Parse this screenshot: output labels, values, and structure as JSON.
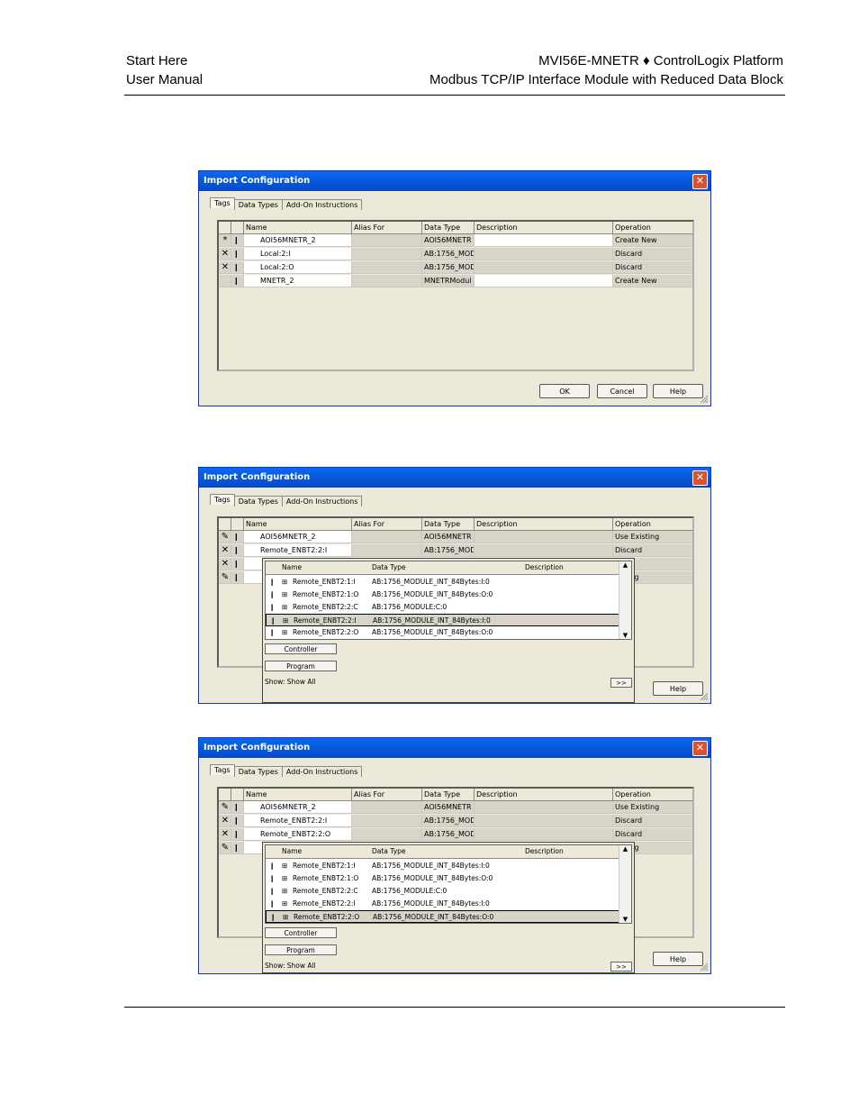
{
  "header": {
    "left_line1": "Start Here",
    "left_line2": "User Manual",
    "right_line1": "MVI56E-MNETR ♦ ControlLogix Platform",
    "right_line2": "Modbus TCP/IP Interface Module with Reduced Data Block"
  },
  "dialog": {
    "title": "Import Configuration",
    "close": "✕",
    "tabs": [
      "Tags",
      "Data Types",
      "Add-On Instructions"
    ],
    "columns": [
      "Name",
      "Alias For",
      "Data Type",
      "Description",
      "Operation"
    ],
    "ok": "OK",
    "cancel": "Cancel",
    "help": "Help",
    "show": "Show: Show All",
    "more": ">>",
    "controller": "Controller",
    "program": "Program",
    "popup_columns": [
      "Name",
      "Data Type",
      "Description"
    ]
  },
  "dialog1": {
    "rows": [
      {
        "marker": "*",
        "name": "AOI56MNETR_2",
        "type": "AOI56MNETR",
        "desc": "",
        "op": "Create New"
      },
      {
        "marker": "✕",
        "name": "Local:2:I",
        "type": "AB:1756_MOD",
        "desc": "",
        "op": "Discard"
      },
      {
        "marker": "✕",
        "name": "Local:2:O",
        "type": "AB:1756_MOD",
        "desc": "",
        "op": "Discard"
      },
      {
        "marker": "",
        "name": "MNETR_2",
        "type": "MNETRModul",
        "desc": "",
        "op": "Create New"
      }
    ]
  },
  "dialog2": {
    "rows": [
      {
        "marker": "✎",
        "name": "AOI56MNETR_2",
        "type": "AOI56MNETR",
        "op": "Use Existing"
      },
      {
        "marker": "✕",
        "name": "Remote_ENBT2:2:I",
        "type": "AB:1756_MOD",
        "op": "Discard"
      },
      {
        "marker": "✕",
        "name": "",
        "type": "",
        "op": "d"
      },
      {
        "marker": "✎",
        "name": "",
        "type": "",
        "op": "xisting"
      }
    ],
    "popup": [
      {
        "name": "Remote_ENBT2:1:I",
        "type": "AB:1756_MODULE_INT_84Bytes:I:0"
      },
      {
        "name": "Remote_ENBT2:1:O",
        "type": "AB:1756_MODULE_INT_84Bytes:O:0"
      },
      {
        "name": "Remote_ENBT2:2:C",
        "type": "AB:1756_MODULE:C:0"
      },
      {
        "name": "Remote_ENBT2:2:I",
        "type": "AB:1756_MODULE_INT_84Bytes:I:0"
      },
      {
        "name": "Remote_ENBT2:2:O",
        "type": "AB:1756_MODULE_INT_84Bytes:O:0"
      }
    ]
  },
  "dialog3": {
    "rows": [
      {
        "marker": "✎",
        "name": "AOI56MNETR_2",
        "type": "AOI56MNETR",
        "op": "Use Existing"
      },
      {
        "marker": "✕",
        "name": "Remote_ENBT2:2:I",
        "type": "AB:1756_MOD",
        "op": "Discard"
      },
      {
        "marker": "✕",
        "name": "Remote_ENBT2:2:O",
        "type": "AB:1756_MOD",
        "op": "Discard"
      },
      {
        "marker": "✎",
        "name": "",
        "type": "",
        "op": "xisting"
      }
    ],
    "popup": [
      {
        "name": "Remote_ENBT2:1:I",
        "type": "AB:1756_MODULE_INT_84Bytes:I:0"
      },
      {
        "name": "Remote_ENBT2:1:O",
        "type": "AB:1756_MODULE_INT_84Bytes:O:0"
      },
      {
        "name": "Remote_ENBT2:2:C",
        "type": "AB:1756_MODULE:C:0"
      },
      {
        "name": "Remote_ENBT2:2:I",
        "type": "AB:1756_MODULE_INT_84Bytes:I:0"
      },
      {
        "name": "Remote_ENBT2:2:O",
        "type": "AB:1756_MODULE_INT_84Bytes:O:0"
      }
    ]
  }
}
